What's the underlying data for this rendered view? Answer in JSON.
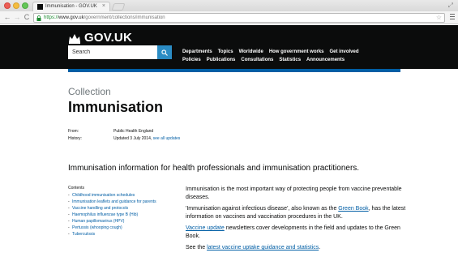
{
  "browser": {
    "tab_title": "Immunisation - GOV.UK",
    "tab_close": "×",
    "url_scheme": "https://",
    "url_host": "www.gov.uk",
    "url_path": "/government/collections/immunisation",
    "back_icon": "←",
    "forward_icon": "→",
    "reload_icon": "C",
    "star_icon": "☆",
    "resize_icon": "⤢"
  },
  "header": {
    "brand": "GOV.UK",
    "search_placeholder": "Search",
    "nav_row1": [
      "Departments",
      "Topics",
      "Worldwide",
      "How government works",
      "Get involved"
    ],
    "nav_row2": [
      "Policies",
      "Publications",
      "Consultations",
      "Statistics",
      "Announcements"
    ]
  },
  "page": {
    "collection_label": "Collection",
    "title": "Immunisation",
    "meta": {
      "from_label": "From:",
      "from_value": "Public Health England",
      "history_label": "History:",
      "history_value": "Updated 3 July 2014,",
      "history_link": "see all updates"
    },
    "lead": "Immunisation information for health professionals and immunisation practitioners.",
    "contents": {
      "heading": "Contents",
      "items": [
        "Childhood immunisation schedules",
        "Immunisation leaflets and guidance for parents",
        "Vaccine handling and protocols",
        "Haemophilus influenzae type B (Hib)",
        "Human papillomavirus (HPV)",
        "Pertussis (whooping cough)",
        "Tuberculosis"
      ]
    },
    "body": {
      "p1": "Immunisation is the most important way of protecting people from vaccine preventable diseases.",
      "p2_before": "'Immunisation against infectious disease', also known as the ",
      "p2_link": "Green Book",
      "p2_after": ", has the latest information on vaccines and vaccination procedures in the UK.",
      "p3_link": "Vaccine update",
      "p3_after": " newsletters cover developments in the field and updates to the Green Book.",
      "p4_before": "See the ",
      "p4_link": "latest vaccine uptake guidance and statistics",
      "p4_after": "."
    }
  },
  "colors": {
    "header_bg": "#0b0c0c",
    "link": "#005ea5",
    "search_button": "#2b8cc4",
    "accent_bar": "#005ea5"
  }
}
